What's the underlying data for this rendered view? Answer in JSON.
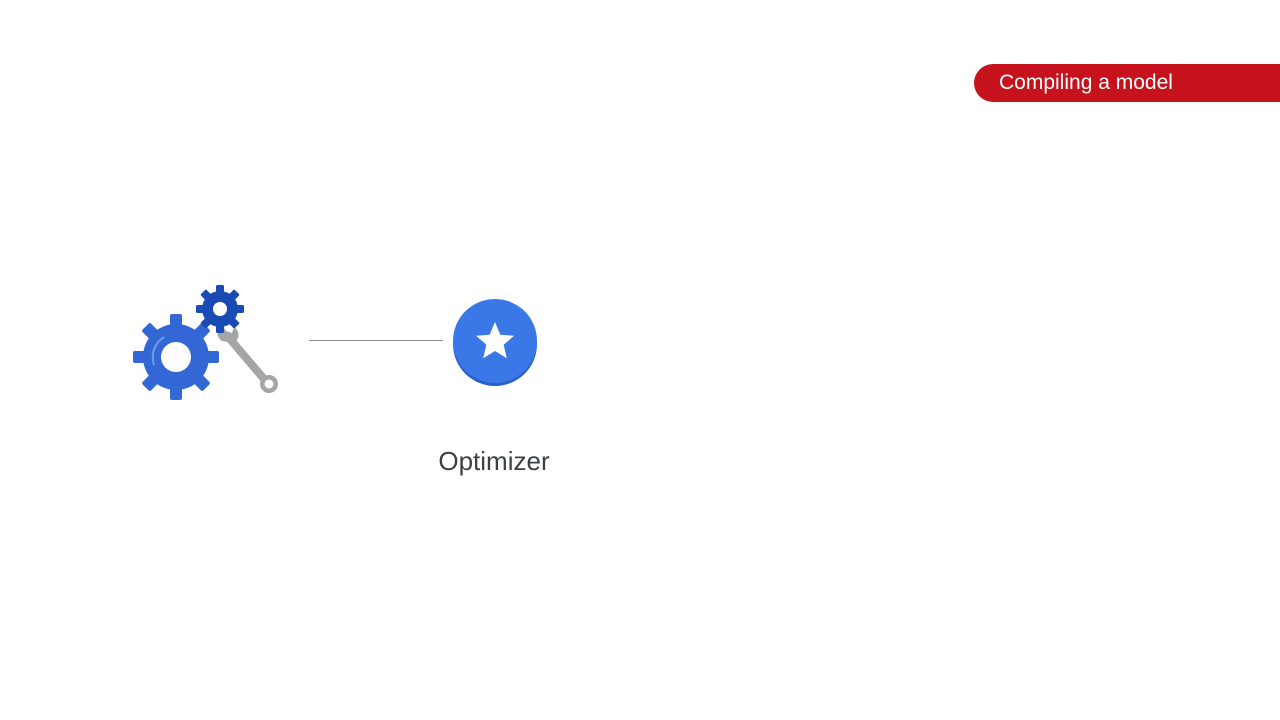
{
  "header": {
    "section_label": "Compiling a model"
  },
  "diagram": {
    "source_icon": "gears-wrench-icon",
    "target_icon": "star-circle-icon",
    "target_label": "Optimizer"
  },
  "colors": {
    "accent_red": "#c5121c",
    "gear_blue": "#3367d6",
    "gear_dark_blue": "#1a4bb5",
    "star_blue": "#3b78e7",
    "wrench_gray": "#a5a5a5",
    "connector_gray": "#8c8c8c",
    "label_text": "#3c4043"
  }
}
